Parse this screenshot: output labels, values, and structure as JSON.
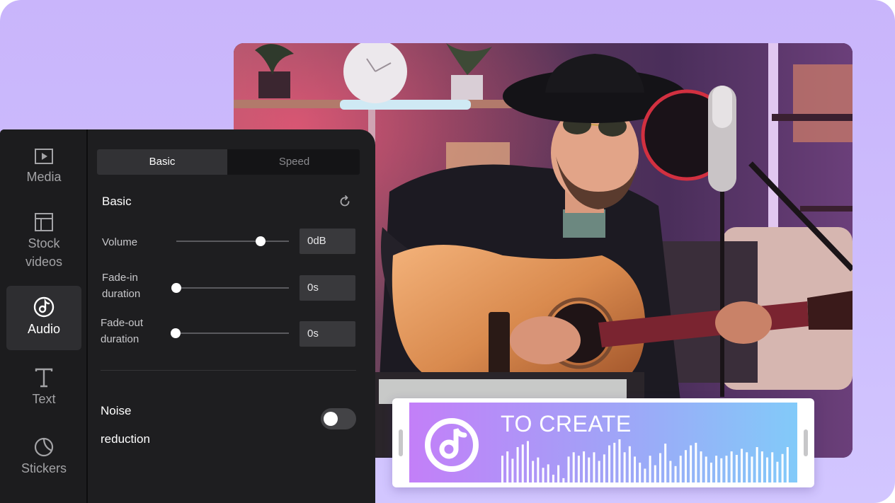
{
  "sidebar": {
    "items": [
      {
        "label_lines": [
          "Media"
        ],
        "icon": "play-icon",
        "active": false
      },
      {
        "label_lines": [
          "Stock",
          "videos"
        ],
        "icon": "layout-icon",
        "active": false
      },
      {
        "label_lines": [
          "Audio"
        ],
        "icon": "music-note-icon",
        "active": true
      },
      {
        "label_lines": [
          "Text"
        ],
        "icon": "text-icon",
        "active": false
      },
      {
        "label_lines": [
          "Stickers"
        ],
        "icon": "sticker-icon",
        "active": false
      }
    ]
  },
  "tabs": [
    {
      "label": "Basic",
      "active": true
    },
    {
      "label": "Speed",
      "active": false
    }
  ],
  "basic": {
    "title": "Basic",
    "reset_icon": "reset-icon",
    "volume": {
      "label": "Volume",
      "value": "0dB",
      "level": 0.75
    },
    "fade_in": {
      "label_lines": [
        "Fade-in",
        "duration"
      ],
      "value": "0s",
      "level": 0
    },
    "fade_out": {
      "label_lines": [
        "Fade-out",
        "duration"
      ],
      "value": "0s",
      "level": 0
    }
  },
  "noise": {
    "label_lines": [
      "Noise",
      "reduction"
    ],
    "enabled": false
  },
  "clip": {
    "title": "TO CREATE",
    "icon": "music-note-icon",
    "waveform": [
      0.62,
      0.72,
      0.55,
      0.82,
      0.88,
      0.96,
      0.5,
      0.58,
      0.34,
      0.42,
      0.18,
      0.4,
      0.1,
      0.6,
      0.7,
      0.62,
      0.72,
      0.58,
      0.7,
      0.5,
      0.65,
      0.86,
      0.92,
      1.0,
      0.7,
      0.84,
      0.6,
      0.46,
      0.32,
      0.62,
      0.4,
      0.68,
      0.9,
      0.5,
      0.38,
      0.62,
      0.75,
      0.86,
      0.92,
      0.72,
      0.6,
      0.46,
      0.62,
      0.56,
      0.62,
      0.72,
      0.64,
      0.78,
      0.7,
      0.6,
      0.82,
      0.72,
      0.58,
      0.7,
      0.48,
      0.66,
      0.82
    ],
    "colors": {
      "start": "#c37ff8",
      "end": "#82caf9"
    }
  },
  "theme": {
    "background": "#cbb9fd",
    "panel": "#1e1e20",
    "accent": "#ffffff"
  }
}
